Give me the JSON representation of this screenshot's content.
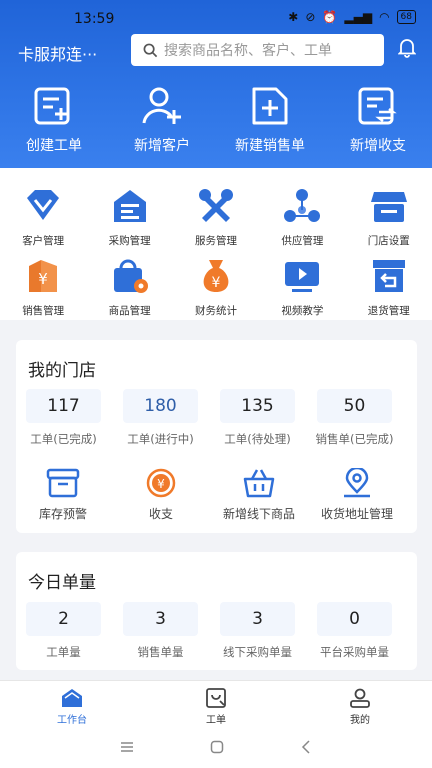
{
  "status": {
    "time": "13:59",
    "battery": "68"
  },
  "topbar": {
    "store_name": "卡服邦连···",
    "search_placeholder": "搜索商品名称、客户、工单"
  },
  "quick_actions": [
    {
      "label": "创建工单",
      "icon": "document-add-icon"
    },
    {
      "label": "新增客户",
      "icon": "user-add-icon"
    },
    {
      "label": "新建销售单",
      "icon": "sales-add-icon"
    },
    {
      "label": "新增收支",
      "icon": "income-expense-icon"
    }
  ],
  "grid": [
    {
      "label": "客户管理",
      "icon": "diamond-icon"
    },
    {
      "label": "采购管理",
      "icon": "purchase-icon"
    },
    {
      "label": "服务管理",
      "icon": "tools-icon"
    },
    {
      "label": "供应管理",
      "icon": "supply-icon"
    },
    {
      "label": "门店设置",
      "icon": "store-icon"
    },
    {
      "label": "销售管理",
      "icon": "sales-icon"
    },
    {
      "label": "商品管理",
      "icon": "goods-icon"
    },
    {
      "label": "财务统计",
      "icon": "money-bag-icon"
    },
    {
      "label": "视频教学",
      "icon": "video-icon"
    },
    {
      "label": "退货管理",
      "icon": "return-icon"
    }
  ],
  "my_store": {
    "title": "我的门店",
    "stats": [
      {
        "value": "117",
        "label": "工单(已完成)"
      },
      {
        "value": "180",
        "label": "工单(进行中)"
      },
      {
        "value": "135",
        "label": "工单(待处理)"
      },
      {
        "value": "50",
        "label": "销售单(已完成)"
      }
    ],
    "services": [
      {
        "label": "库存预警",
        "icon": "inventory-icon"
      },
      {
        "label": "收支",
        "icon": "yen-icon"
      },
      {
        "label": "新增线下商品",
        "icon": "basket-icon"
      },
      {
        "label": "收货地址管理",
        "icon": "location-icon"
      }
    ]
  },
  "today": {
    "title": "今日单量",
    "stats": [
      {
        "value": "2",
        "label": "工单量"
      },
      {
        "value": "3",
        "label": "销售单量"
      },
      {
        "value": "3",
        "label": "线下采购单量"
      },
      {
        "value": "0",
        "label": "平台采购单量"
      }
    ]
  },
  "nav": [
    {
      "label": "工作台",
      "icon": "home-icon",
      "active": true
    },
    {
      "label": "工单",
      "icon": "workorder-icon",
      "active": false
    },
    {
      "label": "我的",
      "icon": "profile-icon",
      "active": false
    }
  ],
  "colors": {
    "brand": "#2f6fd8",
    "header": "#2f75e6",
    "orange": "#f07a2a"
  }
}
